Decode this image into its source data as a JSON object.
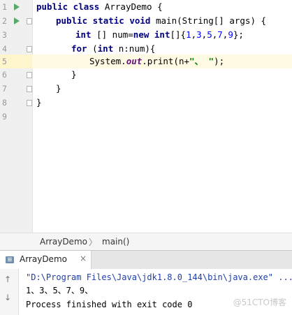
{
  "editor": {
    "line_numbers": [
      "1",
      "2",
      "3",
      "4",
      "5",
      "6",
      "7",
      "8",
      "9"
    ],
    "line1": {
      "kw": "public class",
      "rest": " ArrayDemo {"
    },
    "line2": {
      "kw": "public static void",
      "rest": " main(String[] args) {"
    },
    "line3": {
      "kw1": "int",
      "mid": " [] num=",
      "kw2": "new int",
      "open": "[]{",
      "nums": [
        "1",
        "3",
        "5",
        "7",
        "9"
      ],
      "close": "};"
    },
    "line4": {
      "kw1": "for",
      "p1": " (",
      "kw2": "int",
      "rest": " n:num){"
    },
    "line5": {
      "pre": "System.",
      "static_field": "out",
      "mid": ".print(n+",
      "str": "\"、 \"",
      "close": ");"
    },
    "line6": {
      "text": "}"
    },
    "line7": {
      "text": "}"
    },
    "line8": {
      "text": "}"
    }
  },
  "breadcrumb": {
    "class_name": "ArrayDemo",
    "separator": "〉",
    "method": "main()"
  },
  "run_panel": {
    "tab_label": "ArrayDemo",
    "tab_close": "×",
    "command": "\"D:\\Program Files\\Java\\jdk1.8.0_144\\bin\\java.exe\" ...",
    "output": "1、3、5、7、9、",
    "exit_message": "Process finished with exit code 0",
    "up_arrow": "↑",
    "down_arrow": "↓"
  },
  "watermark": "@51CTO博客",
  "colors": {
    "keyword": "#000080",
    "number": "#0000ff",
    "string": "#008000",
    "static_field": "#660e7a",
    "run_icon": "#59a869",
    "current_line": "#fffae3"
  },
  "icons": [
    "run-icon",
    "fold-icon",
    "console-icon",
    "close-icon",
    "up-arrow-icon",
    "down-arrow-icon"
  ]
}
